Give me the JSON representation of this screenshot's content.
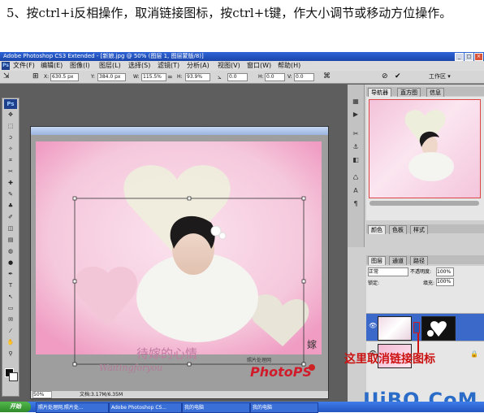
{
  "instruction": "5、按ctrl+i反相操作，取消链接图标，按ctrl+t键，作大小调节或移动方位操作。",
  "titlebar": {
    "title": "Adobe Photoshop CS3 Extended - [新娘.jpg @ 50% (图层 1, 图层蒙版/8)]",
    "buttons": [
      "_",
      "□",
      "×"
    ]
  },
  "menubar": {
    "logo": "Ps",
    "items": [
      "文件(F)",
      "编辑(E)",
      "图像(I)",
      "图层(L)",
      "选择(S)",
      "滤镜(T)",
      "分析(A)",
      "视图(V)",
      "窗口(W)",
      "帮助(H)"
    ]
  },
  "options": {
    "x_label": "X:",
    "x_value": "630.5 px",
    "y_label": "Y:",
    "y_value": "384.0 px",
    "w_label": "W:",
    "w_value": "115.5%",
    "h_label": "H:",
    "h_value": "93.9%",
    "rot_value": "0.0",
    "hskew_label": "H:",
    "hskew_value": "0.0",
    "vskew_label": "V:",
    "vskew_value": "0.0",
    "workspace": "工作区 ▾"
  },
  "toolbox": {
    "logo": "Ps",
    "tools": [
      "move-tool",
      "marquee-tool",
      "lasso-tool",
      "magic-wand-tool",
      "crop-tool",
      "slice-tool",
      "healing-tool",
      "brush-tool",
      "stamp-tool",
      "history-brush-tool",
      "eraser-tool",
      "gradient-tool",
      "blur-tool",
      "dodge-tool",
      "pen-tool",
      "type-tool",
      "path-select-tool",
      "shape-tool",
      "notes-tool",
      "eyedropper-tool",
      "hand-tool",
      "zoom-tool"
    ],
    "glyphs": [
      "✥",
      "⬚",
      "ↄ",
      "✧",
      "⌗",
      "✂",
      "✚",
      "✎",
      "♣",
      "✐",
      "◫",
      "▤",
      "◍",
      "●",
      "✒",
      "T",
      "↖",
      "▭",
      "✉",
      "⁄",
      "✋",
      "⚲"
    ]
  },
  "canvas": {
    "text_title": "待嫁的心情",
    "text_sub": "Waitingforyou",
    "seal": "嫁"
  },
  "statusbar": {
    "zoom": "50%",
    "doc": "文档:3.17M/6.35M"
  },
  "navigator": {
    "tabs": [
      "导航器",
      "直方图",
      "信息"
    ]
  },
  "colors_tabs": [
    "颜色",
    "色板",
    "样式"
  ],
  "layers": {
    "tabs": [
      "图层",
      "通道",
      "路径"
    ],
    "blend_mode": "正常",
    "opacity_label": "不透明度:",
    "opacity_value": "100%",
    "lock_label": "锁定:",
    "fill_label": "填充:",
    "fill_value": "100%"
  },
  "callout": "这里取消链接图标",
  "logo_watermark": {
    "small": "照片处理网",
    "main": "PhotoPS"
  },
  "site_watermark": "UiBQ.CoM",
  "taskbar": {
    "start": "开始",
    "tasks": [
      "照片处理网,照片处...",
      "Adobe Photoshop CS...",
      "我的电脑",
      "我的电脑"
    ],
    "colors": {
      "accent": "#2354c2",
      "start": "#2e8a2b"
    }
  }
}
